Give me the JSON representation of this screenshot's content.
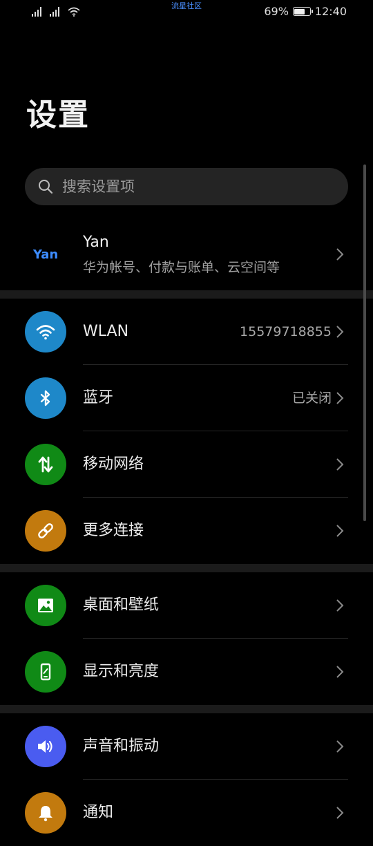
{
  "status_bar": {
    "center_text": "流星社区",
    "battery_text": "69%",
    "battery_level": 0.69,
    "time": "12:40"
  },
  "page": {
    "title": "设置"
  },
  "search": {
    "placeholder": "搜索设置项"
  },
  "account": {
    "avatar_text": "Yan",
    "name": "Yan",
    "subtitle": "华为帐号、付款与账单、云空间等"
  },
  "settings_groups": [
    {
      "items": [
        {
          "label": "WLAN",
          "value": "15579718855",
          "icon": "wifi-icon",
          "color": "#1e88c9"
        },
        {
          "label": "蓝牙",
          "value": "已关闭",
          "icon": "bluetooth-icon",
          "color": "#1e88c9"
        },
        {
          "label": "移动网络",
          "value": "",
          "icon": "mobile-data-icon",
          "color": "#108a16"
        },
        {
          "label": "更多连接",
          "value": "",
          "icon": "link-icon",
          "color": "#c27a0e"
        }
      ]
    },
    {
      "items": [
        {
          "label": "桌面和壁纸",
          "value": "",
          "icon": "image-icon",
          "color": "#108a16"
        },
        {
          "label": "显示和亮度",
          "value": "",
          "icon": "display-icon",
          "color": "#108a16"
        }
      ]
    },
    {
      "items": [
        {
          "label": "声音和振动",
          "value": "",
          "icon": "volume-icon",
          "color": "#4a5cf0"
        },
        {
          "label": "通知",
          "value": "",
          "icon": "bell-icon",
          "color": "#c27a0e"
        }
      ]
    }
  ]
}
